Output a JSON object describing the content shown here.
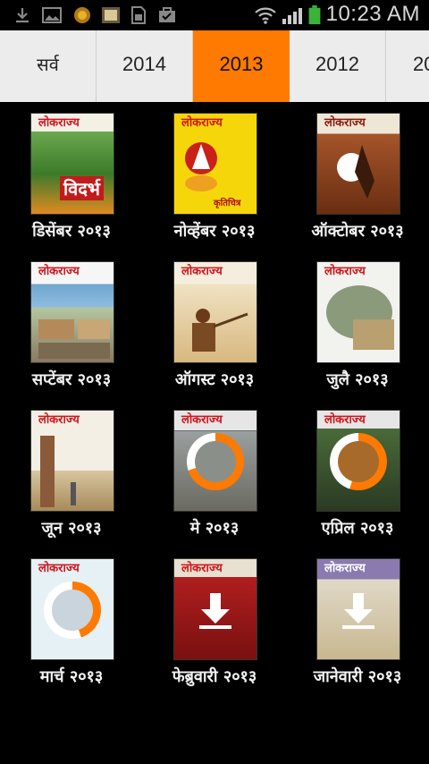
{
  "status_bar": {
    "time": "10:23 AM",
    "icons": [
      "download-icon",
      "image-icon",
      "badge-icon",
      "photo-icon",
      "sim-icon",
      "briefcase-check-icon",
      "wifi-icon",
      "signal-icon",
      "battery-icon"
    ]
  },
  "tabs": [
    {
      "label": "सर्व",
      "active": false
    },
    {
      "label": "2014",
      "active": false
    },
    {
      "label": "2013",
      "active": true
    },
    {
      "label": "2012",
      "active": false
    },
    {
      "label": "20",
      "active": false
    }
  ],
  "issues": [
    {
      "label": "डिसेंबर २०१३",
      "masthead": "लोकराज्य",
      "cover_title": "विदर्भ",
      "status": "downloaded"
    },
    {
      "label": "नोव्हेंबर २०१३",
      "masthead": "लोकराज्य",
      "cover_title": "कृतिचित्र",
      "status": "downloaded"
    },
    {
      "label": "ऑक्टोबर २०१३",
      "masthead": "लोकराज्य",
      "cover_title": "",
      "status": "downloaded"
    },
    {
      "label": "सप्टेंबर २०१३",
      "masthead": "लोकराज्य",
      "cover_title": "",
      "status": "downloaded"
    },
    {
      "label": "ऑगस्ट २०१३",
      "masthead": "लोकराज्य",
      "cover_title": "",
      "status": "downloaded"
    },
    {
      "label": "जुलै २०१३",
      "masthead": "लोकराज्य",
      "cover_title": "",
      "status": "downloaded"
    },
    {
      "label": "जून २०१३",
      "masthead": "लोकराज्य",
      "cover_title": "",
      "status": "downloaded"
    },
    {
      "label": "मे २०१३",
      "masthead": "लोकराज्य",
      "cover_title": "",
      "status": "downloading",
      "progress": 0.7
    },
    {
      "label": "एप्रिल २०१३",
      "masthead": "लोकराज्य",
      "cover_title": "",
      "status": "downloading",
      "progress": 0.55
    },
    {
      "label": "मार्च २०१३",
      "masthead": "लोकराज्य",
      "cover_title": "",
      "status": "downloading",
      "progress": 0.45
    },
    {
      "label": "फेब्रुवारी २०१३",
      "masthead": "लोकराज्य",
      "cover_title": "",
      "status": "not-downloaded"
    },
    {
      "label": "जानेवारी २०१३",
      "masthead": "लोकराज्य",
      "cover_title": "",
      "status": "not-downloaded"
    }
  ],
  "colors": {
    "accent": "#ff7a00",
    "tab_bg": "#ececec",
    "background": "#000000",
    "masthead_red": "#d0141a"
  }
}
